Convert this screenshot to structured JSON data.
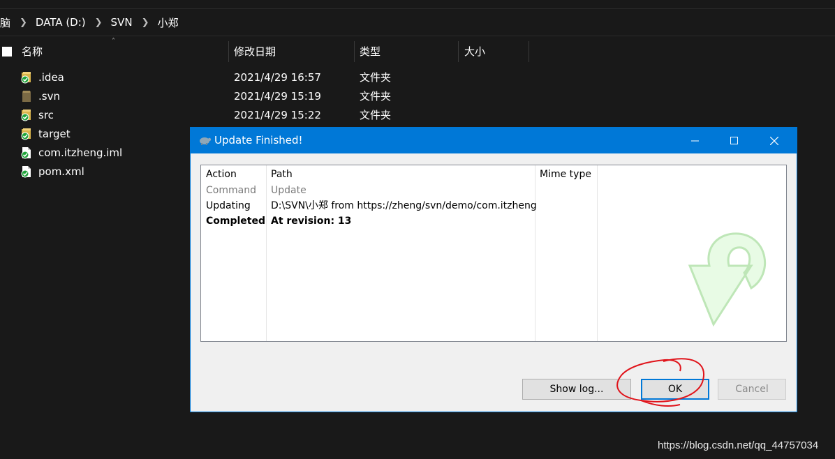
{
  "breadcrumb": [
    "脑",
    "DATA (D:)",
    "SVN",
    "小郑"
  ],
  "columns": {
    "name": "名称",
    "modified": "修改日期",
    "type": "类型",
    "size": "大小"
  },
  "files": [
    {
      "name": ".idea",
      "date": "2021/4/29 16:57",
      "type": "文件夹",
      "icon": "svn-folder-ok-icon"
    },
    {
      "name": ".svn",
      "date": "2021/4/29 15:19",
      "type": "文件夹",
      "icon": "folder-icon"
    },
    {
      "name": "src",
      "date": "2021/4/29 15:22",
      "type": "文件夹",
      "icon": "svn-folder-ok-icon"
    },
    {
      "name": "target",
      "date": "",
      "type": "",
      "icon": "svn-folder-ok-icon"
    },
    {
      "name": "com.itzheng.iml",
      "date": "",
      "type": "",
      "icon": "svn-file-ok-icon"
    },
    {
      "name": "pom.xml",
      "date": "",
      "type": "",
      "icon": "svn-file-ok-icon"
    }
  ],
  "dialog": {
    "title": "Update Finished!",
    "headers": {
      "action": "Action",
      "path": "Path",
      "mime": "Mime type"
    },
    "rows": [
      {
        "action": "Command",
        "path": "Update",
        "style": "gray"
      },
      {
        "action": "Updating",
        "path": "D:\\SVN\\小郑 from https://zheng/svn/demo/com.itzheng",
        "style": "normal"
      },
      {
        "action": "Completed",
        "path": "At revision: 13",
        "style": "bold"
      }
    ],
    "buttons": {
      "show_log": "Show log...",
      "ok": "OK",
      "cancel": "Cancel"
    }
  },
  "watermark": "https://blog.csdn.net/qq_44757034",
  "colors": {
    "accent": "#0078d7",
    "explorer_bg": "#191919",
    "annotation": "#e0131a"
  }
}
